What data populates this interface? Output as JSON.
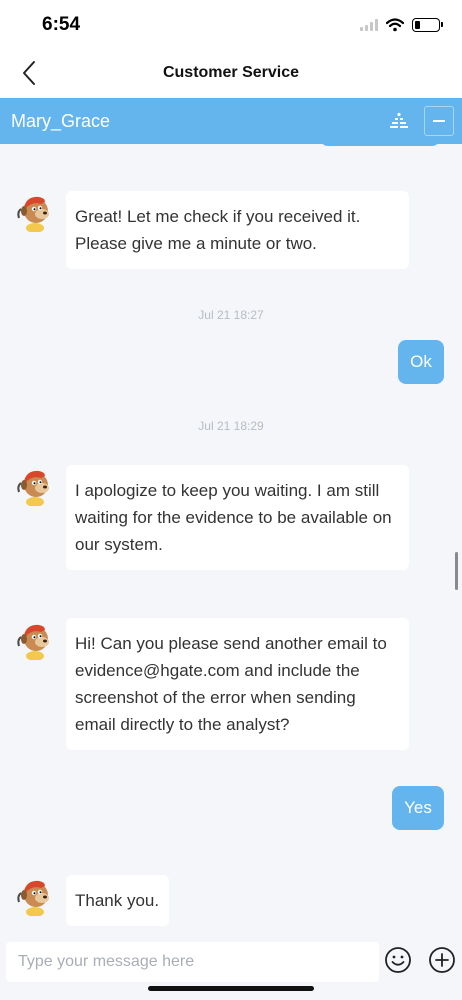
{
  "status_bar": {
    "time": "6:54"
  },
  "nav": {
    "title": "Customer Service",
    "back_icon": "chevron-left-icon"
  },
  "chat_header": {
    "agent_name": "Mary_Grace",
    "icons": [
      "widget-icon",
      "minimize-icon"
    ]
  },
  "colors": {
    "accent": "#64b5ee",
    "background": "#f4f6f9",
    "bubble_in": "#ffffff",
    "text": "#333333"
  },
  "messages": [
    {
      "sender": "agent",
      "text": "Great! Let me check if you received it. Please give me a minute or two."
    },
    {
      "sender": "time",
      "text": "Jul 21 18:27"
    },
    {
      "sender": "user",
      "text": "Ok"
    },
    {
      "sender": "time",
      "text": "Jul 21 18:29"
    },
    {
      "sender": "agent",
      "text": "I apologize to keep you waiting. I am still waiting for the evidence to be available on our system."
    },
    {
      "sender": "agent",
      "text": "Hi! Can you please send another email to evidence@hgate.com and include the screenshot of the error when sending email directly to the analyst?"
    },
    {
      "sender": "user",
      "text": "Yes"
    },
    {
      "sender": "agent",
      "text": "Thank you."
    }
  ],
  "input": {
    "placeholder": "Type your message here",
    "value": "",
    "icons": [
      "emoji-icon",
      "add-icon"
    ]
  }
}
